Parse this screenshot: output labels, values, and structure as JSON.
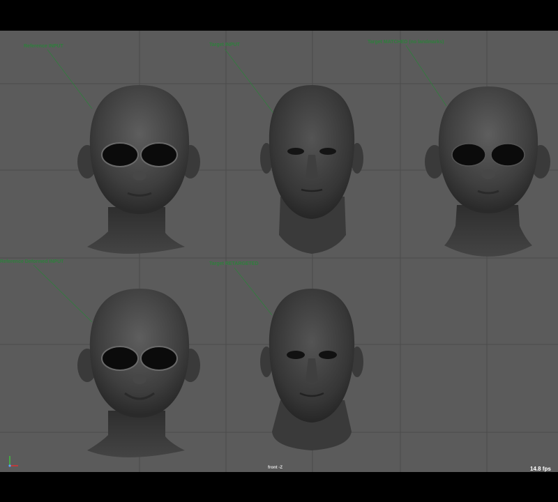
{
  "viewport": {
    "camera": "front -Z",
    "fps": "14.8 fps"
  },
  "annotations": [
    "Reference INPUT",
    "Target INPUT",
    "Target MATCHED (no landmarks)",
    "Reference Deformed INPUT",
    "Target RETARGETED"
  ],
  "colors": {
    "background": "#5b5b5b",
    "grid": "#4a4a4a",
    "annotation": "#2e7f3c"
  },
  "icons": {
    "axis": "view-axis-icon"
  }
}
